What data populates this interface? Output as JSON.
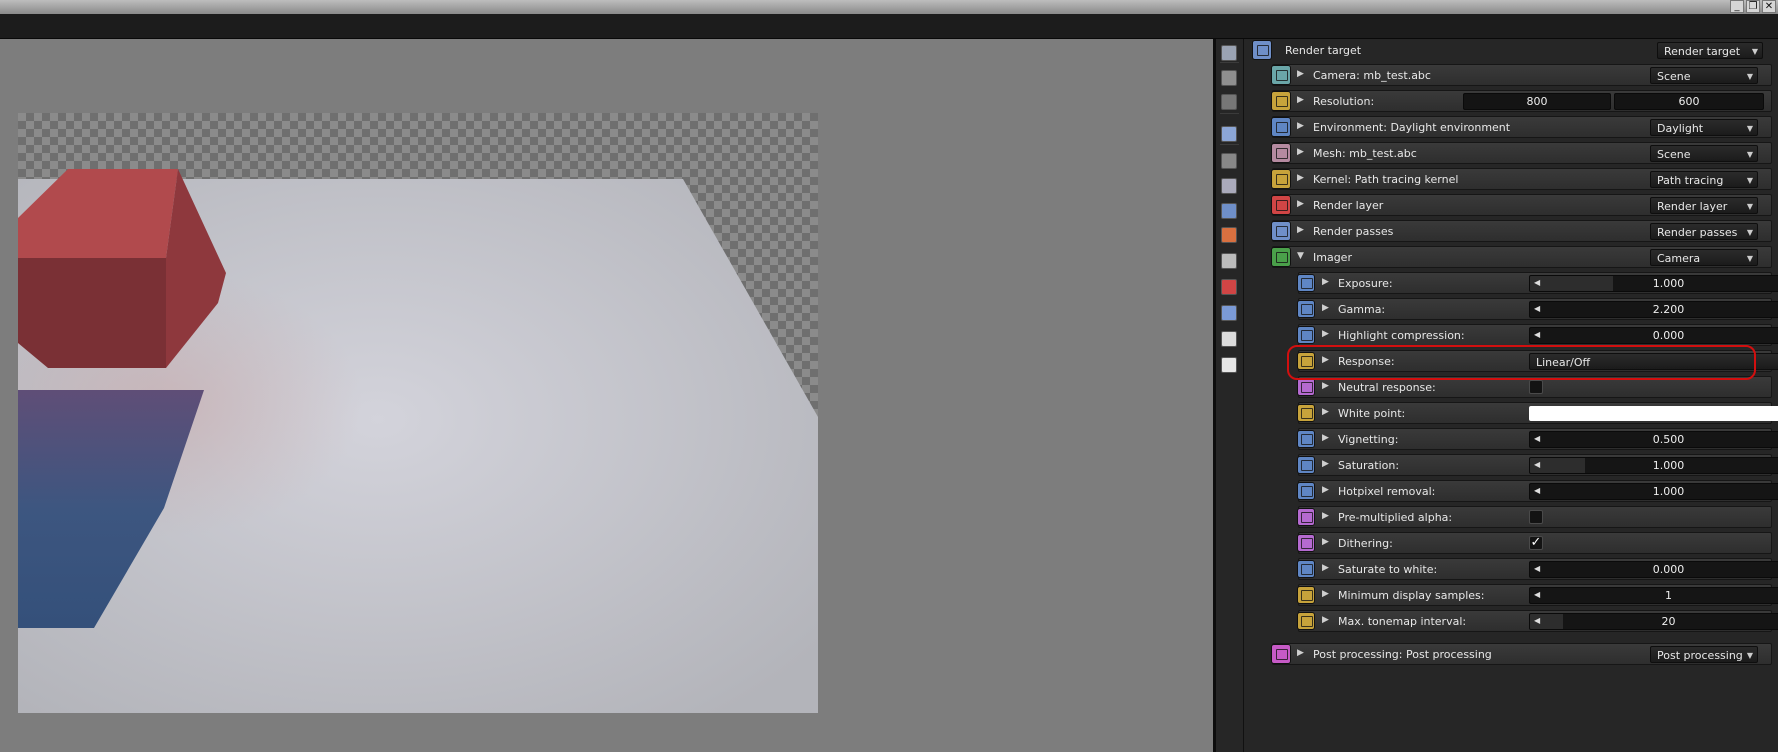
{
  "window": {
    "controls": {
      "minimize": "_",
      "restore": "❐",
      "close": "✕"
    }
  },
  "colors": {
    "accent_highlight": "#d20f0f",
    "panel_bg": "#262626",
    "viewport_bg": "#7d7d7d"
  },
  "toolbar": {
    "icons": [
      "render-target-icon",
      "layers-icon",
      "tree-icon",
      "image-icon",
      "camera-icon",
      "film-settings-icon",
      "environment-icon",
      "material-icon",
      "kernel-icon",
      "render-layer-icon",
      "render-passes-icon",
      "imager-icon",
      "post-processing-icon"
    ]
  },
  "inspector": {
    "header": {
      "label": "Render target",
      "dropdown": "Render target"
    },
    "nodes": [
      {
        "label": "Camera: mb_test.abc",
        "dropdown": "Scene",
        "icon": "camera-icon",
        "color": "#6aa6a8"
      },
      {
        "label": "Resolution:",
        "values": [
          "800",
          "600"
        ],
        "icon": "resolution-icon",
        "color": "#c7a33b"
      },
      {
        "label": "Environment: Daylight environment",
        "dropdown": "Daylight",
        "icon": "environment-icon",
        "color": "#5f86c4"
      },
      {
        "label": "Mesh: mb_test.abc",
        "dropdown": "Scene",
        "icon": "mesh-icon",
        "color": "#b58aa0"
      },
      {
        "label": "Kernel: Path tracing kernel",
        "dropdown": "Path tracing",
        "icon": "kernel-icon",
        "color": "#c7a33b"
      },
      {
        "label": "Render layer",
        "dropdown": "Render layer",
        "icon": "render-layer-icon",
        "color": "#d04545"
      },
      {
        "label": "Render passes",
        "dropdown": "Render passes",
        "icon": "render-passes-icon",
        "color": "#6f8fc8"
      },
      {
        "label": "Imager",
        "dropdown": "Camera",
        "icon": "imager-icon",
        "color": "#4aa04a"
      }
    ],
    "imager_params": [
      {
        "label": "Exposure:",
        "kind": "slider",
        "value": "1.000",
        "fill": 0.3,
        "icon": "float-icon",
        "color": "#5f86c4"
      },
      {
        "label": "Gamma:",
        "kind": "slider",
        "value": "2.200",
        "fill": 0.0,
        "icon": "float-icon",
        "color": "#5f86c4"
      },
      {
        "label": "Highlight compression:",
        "kind": "slider",
        "value": "0.000",
        "fill": 0.0,
        "icon": "float-icon",
        "color": "#5f86c4"
      },
      {
        "label": "Response:",
        "kind": "dropdown",
        "value": "Linear/Off",
        "icon": "enum-icon",
        "color": "#c7a33b"
      },
      {
        "label": "Neutral response:",
        "kind": "check",
        "value": "",
        "icon": "bool-icon",
        "color": "#b56ad0"
      },
      {
        "label": "White point:",
        "kind": "color",
        "value": "",
        "icon": "rgb-icon",
        "color": "#c7a33b"
      },
      {
        "label": "Vignetting:",
        "kind": "slider",
        "value": "0.500",
        "fill": 0.0,
        "icon": "float-icon",
        "color": "#5f86c4"
      },
      {
        "label": "Saturation:",
        "kind": "slider",
        "value": "1.000",
        "fill": 0.2,
        "icon": "float-icon",
        "color": "#5f86c4"
      },
      {
        "label": "Hotpixel removal:",
        "kind": "slider",
        "value": "1.000",
        "fill": 0.0,
        "icon": "float-icon",
        "color": "#5f86c4"
      },
      {
        "label": "Pre-multiplied alpha:",
        "kind": "check",
        "value": "",
        "icon": "bool-icon",
        "color": "#b56ad0"
      },
      {
        "label": "Dithering:",
        "kind": "check",
        "value": "✓",
        "icon": "bool-icon",
        "color": "#b56ad0"
      },
      {
        "label": "Saturate to white:",
        "kind": "slider",
        "value": "0.000",
        "fill": 0.0,
        "icon": "float-icon",
        "color": "#5f86c4"
      },
      {
        "label": "Minimum display samples:",
        "kind": "slider",
        "value": "1",
        "fill": 0.0,
        "icon": "int-icon",
        "color": "#c7a33b"
      },
      {
        "label": "Max. tonemap interval:",
        "kind": "slider",
        "value": "20",
        "fill": 0.12,
        "icon": "int-icon",
        "color": "#c7a33b"
      }
    ],
    "post": {
      "label": "Post processing: Post processing",
      "dropdown": "Post processing",
      "icon": "post-processing-icon",
      "color": "#c65ac6"
    }
  }
}
